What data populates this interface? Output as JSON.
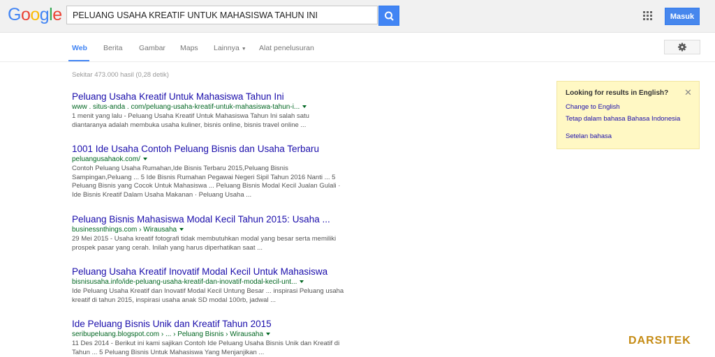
{
  "header": {
    "logo": "Google",
    "query": "PELUANG USAHA KREATIF UNTUK MAHASISWA TAHUN INI",
    "signin_label": "Masuk"
  },
  "tabs": [
    {
      "label": "Web"
    },
    {
      "label": "Berita"
    },
    {
      "label": "Gambar"
    },
    {
      "label": "Maps"
    },
    {
      "label": "Lainnya"
    },
    {
      "label": "Alat penelusuran"
    }
  ],
  "stats": "Sekitar 473.000 hasil (0,28 detik)",
  "results": [
    {
      "title": "Peluang Usaha Kreatif Untuk Mahasiswa Tahun Ini",
      "url": "www . situs-anda . com/peluang-usaha-kreatif-untuk-mahasiswa-tahun-i...",
      "snippet": "1 menit yang lalu - Peluang Usaha Kreatif Untuk Mahasiswa Tahun Ini salah satu diantaranya adalah membuka usaha kuliner, bisnis online, bisnis travel online ..."
    },
    {
      "title": "1001 Ide Usaha Contoh Peluang Bisnis dan Usaha Terbaru",
      "url": "peluangusahaok.com/",
      "snippet": "Contoh Peluang Usaha Rumahan,Ide Bisnis Terbaru 2015,Peluang Bisnis Sampingan,Peluang ... 5 Ide Bisnis Rumahan Pegawai Negeri Sipil Tahun 2016 Nanti ... 5 Peluang Bisnis yang Cocok Untuk Mahasiswa ... Peluang Bisnis Modal Kecil Jualan Gulali · Ide Bisnis Kreatif Dalam Usaha Makanan · Peluang Usaha ..."
    },
    {
      "title": "Peluang Bisnis Mahasiswa Modal Kecil Tahun 2015: Usaha ...",
      "url": "businessnthings.com › Wirausaha",
      "snippet": "29 Mei 2015 - Usaha kreatif fotografi tidak membutuhkan modal yang besar serta memiliki prospek pasar yang cerah. Inilah yang harus diperhatikan saat ..."
    },
    {
      "title": "Peluang Usaha Kreatif Inovatif Modal Kecil Untuk Mahasiswa",
      "url": "bisnisusaha.info/ide-peluang-usaha-kreatif-dan-inovatif-modal-kecil-unt...",
      "snippet": "Ide Peluang Usaha Kreatif dan Inovatif Modal Kecil Untung Besar ... inspirasi Peluang usaha kreatif di tahun 2015, inspirasi usaha anak SD modal 100rb, jadwal ..."
    },
    {
      "title": "Ide Peluang Bisnis Unik dan Kreatif Tahun 2015",
      "url": "seribupeluang.blogspot.com › ... › Peluang Bisnis › Wirausaha",
      "snippet": "11 Des 2014 - Berikut ini kami sajikan Contoh Ide Peluang Usaha Bisnis Unik dan Kreatif di Tahun ... 5 Peluang Bisnis Untuk Mahasiswa Yang Menjanjikan ..."
    }
  ],
  "lang_box": {
    "title": "Looking for results in English?",
    "change": "Change to English",
    "keep": "Tetap dalam bahasa Bahasa Indonesia",
    "settings": "Setelan bahasa",
    "close": "✕"
  },
  "watermark": "DARSITEK",
  "colors": {
    "accent": "#4285f4",
    "link": "#1a0dab",
    "url": "#006621"
  }
}
